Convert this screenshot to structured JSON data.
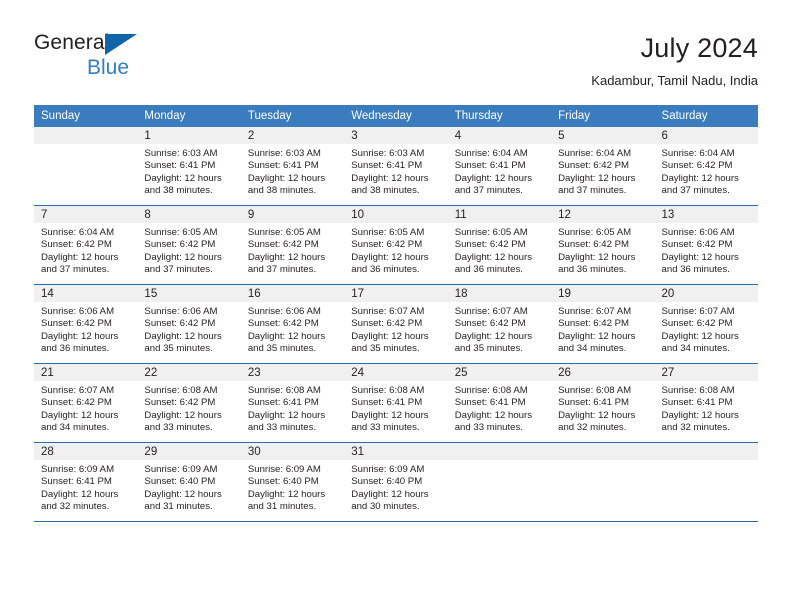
{
  "brand": {
    "name_part1": "General",
    "name_part2": "Blue",
    "accent_color": "#1264a8",
    "secondary_color": "#2f7fc6"
  },
  "header": {
    "title": "July 2024",
    "subtitle": "Kadambur, Tamil Nadu, India"
  },
  "theme": {
    "header_bg": "#3a7cbe",
    "row_divider": "#2b6cad",
    "daynum_band": "#f0f0f0"
  },
  "calendar": {
    "weekday_headers": [
      "Sunday",
      "Monday",
      "Tuesday",
      "Wednesday",
      "Thursday",
      "Friday",
      "Saturday"
    ],
    "labels": {
      "sunrise_prefix": "Sunrise:",
      "sunset_prefix": "Sunset:",
      "daylight_prefix": "Daylight:"
    },
    "weeks": [
      [
        {
          "day": "",
          "l1": "",
          "l2": "",
          "l3": "",
          "l4": ""
        },
        {
          "day": "1",
          "l1": "Sunrise: 6:03 AM",
          "l2": "Sunset: 6:41 PM",
          "l3": "Daylight: 12 hours",
          "l4": "and 38 minutes."
        },
        {
          "day": "2",
          "l1": "Sunrise: 6:03 AM",
          "l2": "Sunset: 6:41 PM",
          "l3": "Daylight: 12 hours",
          "l4": "and 38 minutes."
        },
        {
          "day": "3",
          "l1": "Sunrise: 6:03 AM",
          "l2": "Sunset: 6:41 PM",
          "l3": "Daylight: 12 hours",
          "l4": "and 38 minutes."
        },
        {
          "day": "4",
          "l1": "Sunrise: 6:04 AM",
          "l2": "Sunset: 6:41 PM",
          "l3": "Daylight: 12 hours",
          "l4": "and 37 minutes."
        },
        {
          "day": "5",
          "l1": "Sunrise: 6:04 AM",
          "l2": "Sunset: 6:42 PM",
          "l3": "Daylight: 12 hours",
          "l4": "and 37 minutes."
        },
        {
          "day": "6",
          "l1": "Sunrise: 6:04 AM",
          "l2": "Sunset: 6:42 PM",
          "l3": "Daylight: 12 hours",
          "l4": "and 37 minutes."
        }
      ],
      [
        {
          "day": "7",
          "l1": "Sunrise: 6:04 AM",
          "l2": "Sunset: 6:42 PM",
          "l3": "Daylight: 12 hours",
          "l4": "and 37 minutes."
        },
        {
          "day": "8",
          "l1": "Sunrise: 6:05 AM",
          "l2": "Sunset: 6:42 PM",
          "l3": "Daylight: 12 hours",
          "l4": "and 37 minutes."
        },
        {
          "day": "9",
          "l1": "Sunrise: 6:05 AM",
          "l2": "Sunset: 6:42 PM",
          "l3": "Daylight: 12 hours",
          "l4": "and 37 minutes."
        },
        {
          "day": "10",
          "l1": "Sunrise: 6:05 AM",
          "l2": "Sunset: 6:42 PM",
          "l3": "Daylight: 12 hours",
          "l4": "and 36 minutes."
        },
        {
          "day": "11",
          "l1": "Sunrise: 6:05 AM",
          "l2": "Sunset: 6:42 PM",
          "l3": "Daylight: 12 hours",
          "l4": "and 36 minutes."
        },
        {
          "day": "12",
          "l1": "Sunrise: 6:05 AM",
          "l2": "Sunset: 6:42 PM",
          "l3": "Daylight: 12 hours",
          "l4": "and 36 minutes."
        },
        {
          "day": "13",
          "l1": "Sunrise: 6:06 AM",
          "l2": "Sunset: 6:42 PM",
          "l3": "Daylight: 12 hours",
          "l4": "and 36 minutes."
        }
      ],
      [
        {
          "day": "14",
          "l1": "Sunrise: 6:06 AM",
          "l2": "Sunset: 6:42 PM",
          "l3": "Daylight: 12 hours",
          "l4": "and 36 minutes."
        },
        {
          "day": "15",
          "l1": "Sunrise: 6:06 AM",
          "l2": "Sunset: 6:42 PM",
          "l3": "Daylight: 12 hours",
          "l4": "and 35 minutes."
        },
        {
          "day": "16",
          "l1": "Sunrise: 6:06 AM",
          "l2": "Sunset: 6:42 PM",
          "l3": "Daylight: 12 hours",
          "l4": "and 35 minutes."
        },
        {
          "day": "17",
          "l1": "Sunrise: 6:07 AM",
          "l2": "Sunset: 6:42 PM",
          "l3": "Daylight: 12 hours",
          "l4": "and 35 minutes."
        },
        {
          "day": "18",
          "l1": "Sunrise: 6:07 AM",
          "l2": "Sunset: 6:42 PM",
          "l3": "Daylight: 12 hours",
          "l4": "and 35 minutes."
        },
        {
          "day": "19",
          "l1": "Sunrise: 6:07 AM",
          "l2": "Sunset: 6:42 PM",
          "l3": "Daylight: 12 hours",
          "l4": "and 34 minutes."
        },
        {
          "day": "20",
          "l1": "Sunrise: 6:07 AM",
          "l2": "Sunset: 6:42 PM",
          "l3": "Daylight: 12 hours",
          "l4": "and 34 minutes."
        }
      ],
      [
        {
          "day": "21",
          "l1": "Sunrise: 6:07 AM",
          "l2": "Sunset: 6:42 PM",
          "l3": "Daylight: 12 hours",
          "l4": "and 34 minutes."
        },
        {
          "day": "22",
          "l1": "Sunrise: 6:08 AM",
          "l2": "Sunset: 6:42 PM",
          "l3": "Daylight: 12 hours",
          "l4": "and 33 minutes."
        },
        {
          "day": "23",
          "l1": "Sunrise: 6:08 AM",
          "l2": "Sunset: 6:41 PM",
          "l3": "Daylight: 12 hours",
          "l4": "and 33 minutes."
        },
        {
          "day": "24",
          "l1": "Sunrise: 6:08 AM",
          "l2": "Sunset: 6:41 PM",
          "l3": "Daylight: 12 hours",
          "l4": "and 33 minutes."
        },
        {
          "day": "25",
          "l1": "Sunrise: 6:08 AM",
          "l2": "Sunset: 6:41 PM",
          "l3": "Daylight: 12 hours",
          "l4": "and 33 minutes."
        },
        {
          "day": "26",
          "l1": "Sunrise: 6:08 AM",
          "l2": "Sunset: 6:41 PM",
          "l3": "Daylight: 12 hours",
          "l4": "and 32 minutes."
        },
        {
          "day": "27",
          "l1": "Sunrise: 6:08 AM",
          "l2": "Sunset: 6:41 PM",
          "l3": "Daylight: 12 hours",
          "l4": "and 32 minutes."
        }
      ],
      [
        {
          "day": "28",
          "l1": "Sunrise: 6:09 AM",
          "l2": "Sunset: 6:41 PM",
          "l3": "Daylight: 12 hours",
          "l4": "and 32 minutes."
        },
        {
          "day": "29",
          "l1": "Sunrise: 6:09 AM",
          "l2": "Sunset: 6:40 PM",
          "l3": "Daylight: 12 hours",
          "l4": "and 31 minutes."
        },
        {
          "day": "30",
          "l1": "Sunrise: 6:09 AM",
          "l2": "Sunset: 6:40 PM",
          "l3": "Daylight: 12 hours",
          "l4": "and 31 minutes."
        },
        {
          "day": "31",
          "l1": "Sunrise: 6:09 AM",
          "l2": "Sunset: 6:40 PM",
          "l3": "Daylight: 12 hours",
          "l4": "and 30 minutes."
        },
        {
          "day": "",
          "l1": "",
          "l2": "",
          "l3": "",
          "l4": ""
        },
        {
          "day": "",
          "l1": "",
          "l2": "",
          "l3": "",
          "l4": ""
        },
        {
          "day": "",
          "l1": "",
          "l2": "",
          "l3": "",
          "l4": ""
        }
      ]
    ]
  }
}
